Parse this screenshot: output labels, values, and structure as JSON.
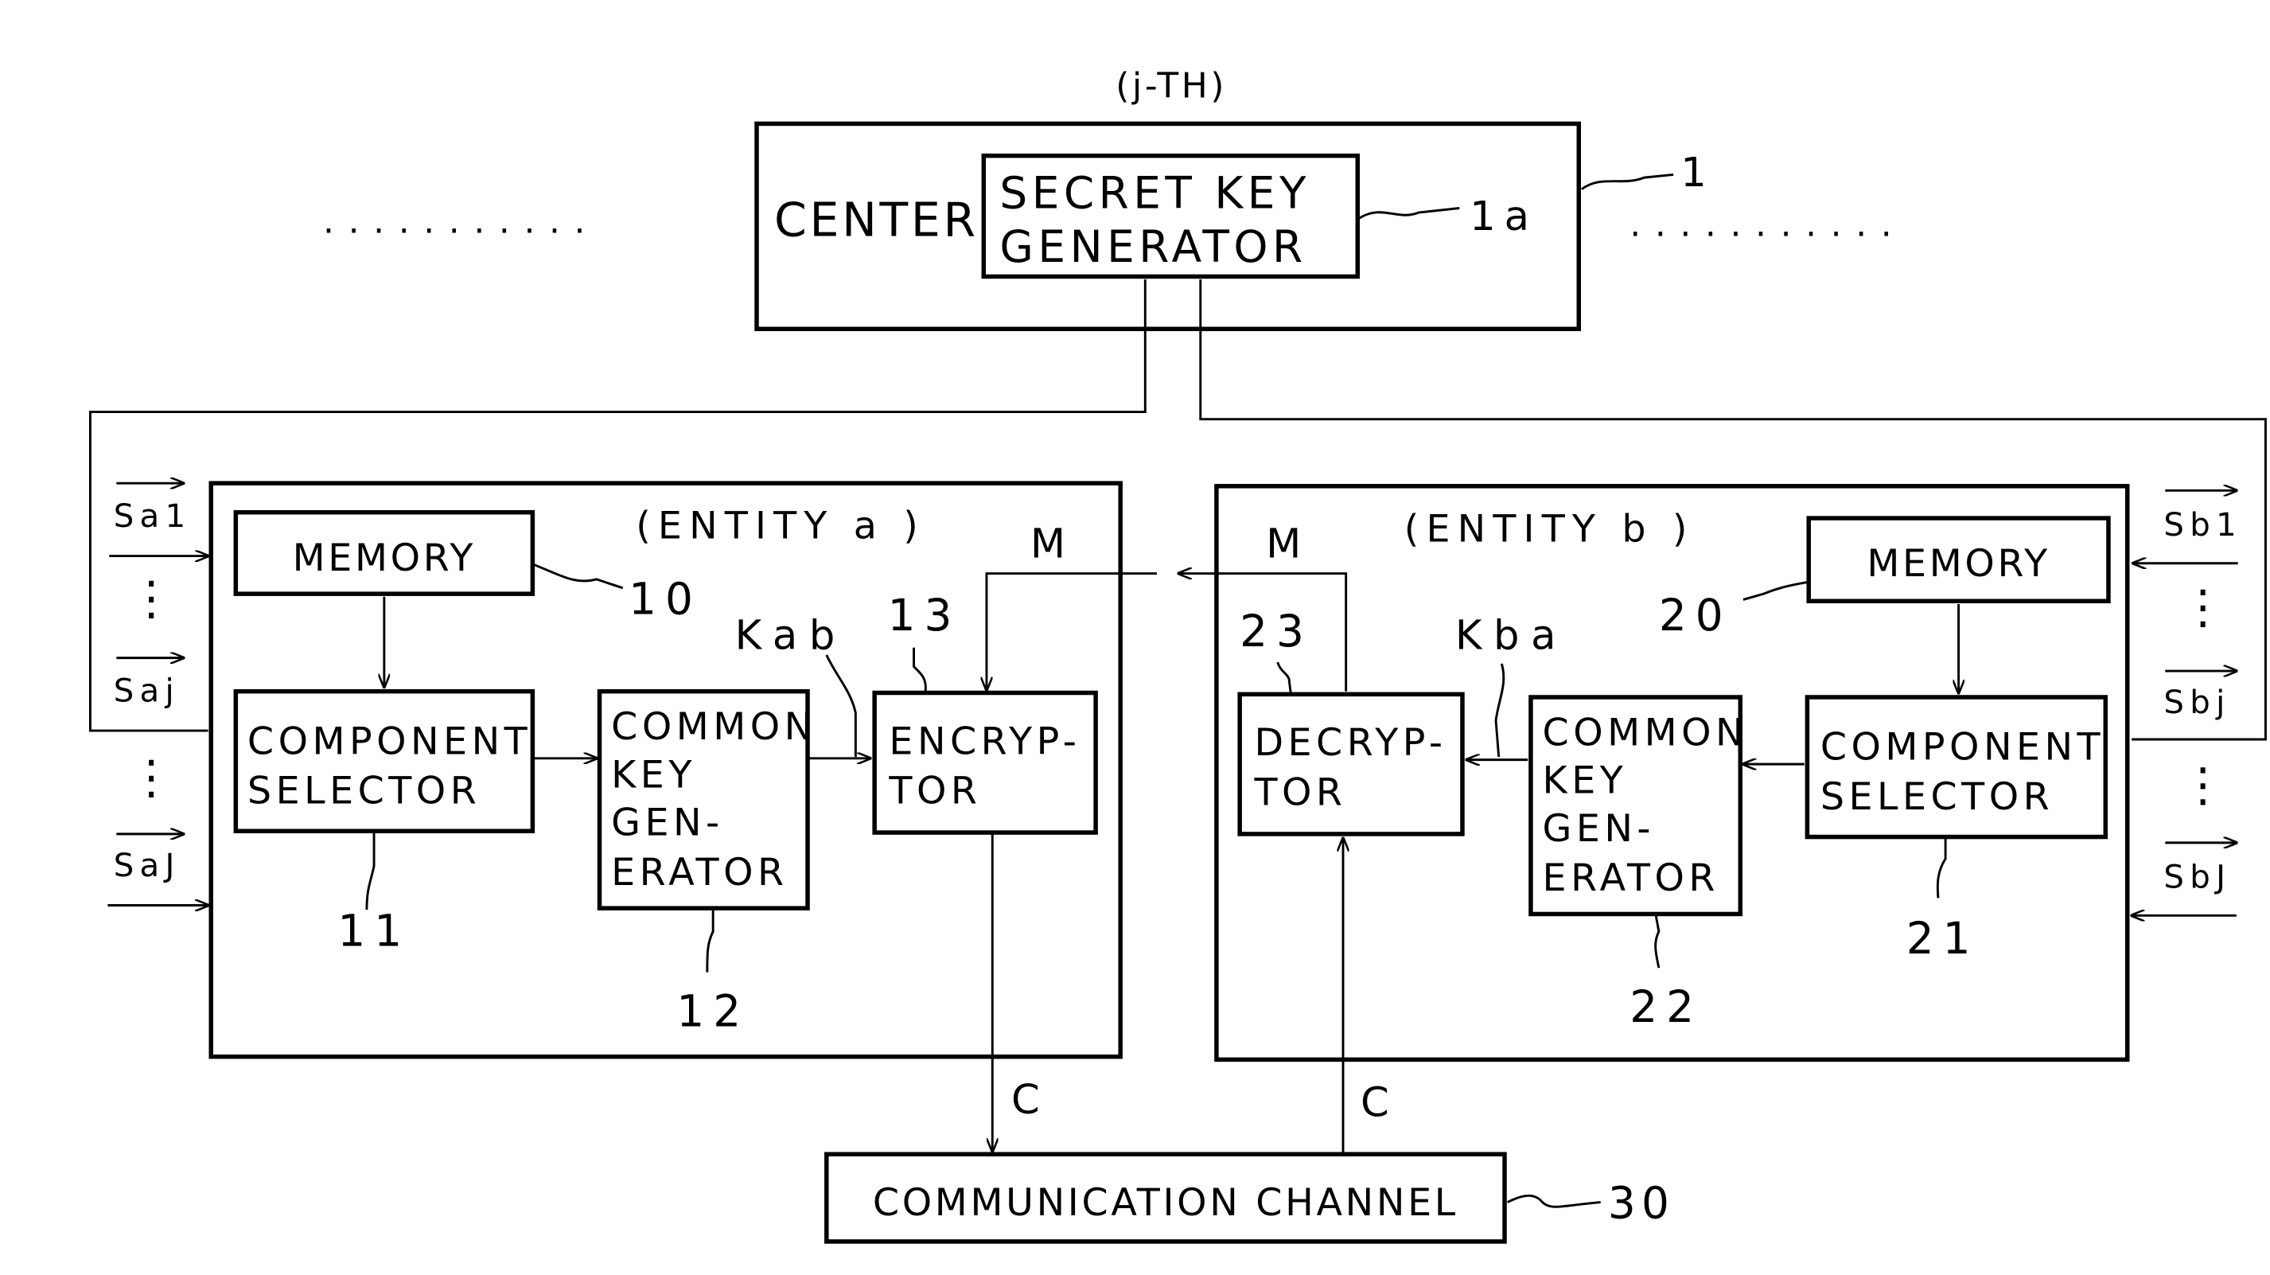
{
  "figure": {
    "center_block": {
      "header": "(j-TH)",
      "label": "CENTER",
      "ref": "1",
      "inner": {
        "lines": [
          "SECRET KEY",
          "GENERATOR"
        ],
        "ref": "1a"
      },
      "ellipsis_left": ". . . . . . . . . . .",
      "ellipsis_right": ". . . . . . . . . . ."
    },
    "entity_a": {
      "title": "(ENTITY a )",
      "inputs": [
        "Sa1",
        "Saj",
        "SaJ"
      ],
      "memory": {
        "label": "MEMORY",
        "ref": "10"
      },
      "selector": {
        "lines": [
          "COMPONENT",
          "SELECTOR"
        ],
        "ref": "11"
      },
      "keygen": {
        "lines": [
          "COMMON",
          "KEY",
          "GEN-",
          "ERATOR"
        ],
        "ref": "12"
      },
      "crypto": {
        "lines": [
          "ENCRYP-",
          "TOR"
        ],
        "ref": "13"
      },
      "key_label": "Kab",
      "msg_label": "M",
      "out_label": "C"
    },
    "entity_b": {
      "title": "(ENTITY b )",
      "inputs": [
        "Sb1",
        "Sbj",
        "SbJ"
      ],
      "memory": {
        "label": "MEMORY",
        "ref": "20"
      },
      "selector": {
        "lines": [
          "COMPONENT",
          "SELECTOR"
        ],
        "ref": "21"
      },
      "keygen": {
        "lines": [
          "COMMON",
          "KEY",
          "GEN-",
          "ERATOR"
        ],
        "ref": "22"
      },
      "crypto": {
        "lines": [
          "DECRYP-",
          "TOR"
        ],
        "ref": "23"
      },
      "key_label": "Kba",
      "msg_label": "M",
      "out_label": "C"
    },
    "channel": {
      "label": "COMMUNICATION CHANNEL",
      "ref": "30"
    },
    "vertical_dots": "⋮"
  }
}
